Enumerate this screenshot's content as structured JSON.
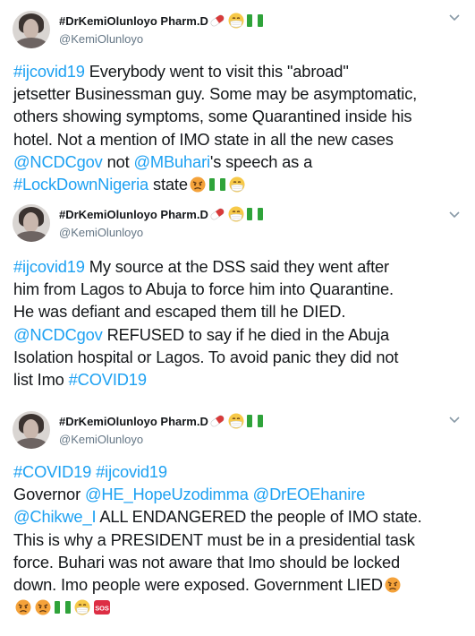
{
  "tweets": [
    {
      "display_name": "#DrKemiOlunloyo Pharm.D",
      "handle": "@KemiOlunloyo",
      "lines": [
        [
          {
            "t": "tag",
            "v": "#ijcovid19"
          },
          {
            "t": "text",
            "v": " Everybody went to visit this \"abroad\""
          }
        ],
        [
          {
            "t": "text",
            "v": "jetsetter Businessman guy. Some may be asymptomatic,"
          }
        ],
        [
          {
            "t": "text",
            "v": "others showing symptoms, some Quarantined inside his"
          }
        ],
        [
          {
            "t": "text",
            "v": "hotel. Not a mention of IMO state in all the new cases"
          }
        ],
        [
          {
            "t": "mention",
            "v": "@NCDCgov"
          },
          {
            "t": "text",
            "v": " not "
          },
          {
            "t": "mention",
            "v": "@MBuhari"
          },
          {
            "t": "text",
            "v": "'s speech as a"
          }
        ],
        [
          {
            "t": "tag",
            "v": "#LockDownNigeria"
          },
          {
            "t": "text",
            "v": " state"
          },
          {
            "t": "emoji",
            "v": "angry"
          },
          {
            "t": "emoji",
            "v": "flag-ng"
          },
          {
            "t": "emoji",
            "v": "mask"
          }
        ]
      ]
    },
    {
      "display_name": "#DrKemiOlunloyo Pharm.D",
      "handle": "@KemiOlunloyo",
      "lines": [
        [
          {
            "t": "tag",
            "v": "#ijcovid19"
          },
          {
            "t": "text",
            "v": " My source at the DSS said they went after"
          }
        ],
        [
          {
            "t": "text",
            "v": "him from Lagos to Abuja to force him into Quarantine."
          }
        ],
        [
          {
            "t": "text",
            "v": "He was defiant and escaped them till he DIED."
          }
        ],
        [
          {
            "t": "mention",
            "v": "@NCDCgov"
          },
          {
            "t": "text",
            "v": " REFUSED to say if he died in the Abuja"
          }
        ],
        [
          {
            "t": "text",
            "v": "Isolation hospital or Lagos. To avoid panic they did not"
          }
        ],
        [
          {
            "t": "text",
            "v": "list Imo "
          },
          {
            "t": "tag",
            "v": "#COVID19"
          }
        ]
      ]
    },
    {
      "display_name": "#DrKemiOlunloyo Pharm.D",
      "handle": "@KemiOlunloyo",
      "lines": [
        [
          {
            "t": "tag",
            "v": "#COVID19"
          },
          {
            "t": "text",
            "v": " "
          },
          {
            "t": "tag",
            "v": "#ijcovid19"
          }
        ],
        [
          {
            "t": "text",
            "v": "Governor "
          },
          {
            "t": "mention",
            "v": "@HE_HopeUzodimma"
          },
          {
            "t": "text",
            "v": " "
          },
          {
            "t": "mention",
            "v": "@DrEOEhanire"
          }
        ],
        [
          {
            "t": "mention",
            "v": "@Chikwe_I"
          },
          {
            "t": "text",
            "v": " ALL ENDANGERED the people of IMO state."
          }
        ],
        [
          {
            "t": "text",
            "v": "This is why a PRESIDENT must be in a presidential task"
          }
        ],
        [
          {
            "t": "text",
            "v": "force. Buhari was not aware that Imo should be locked"
          }
        ],
        [
          {
            "t": "text",
            "v": "down. Imo people were exposed. Government LIED"
          },
          {
            "t": "emoji",
            "v": "angry"
          }
        ],
        [
          {
            "t": "emoji",
            "v": "angry"
          },
          {
            "t": "emoji",
            "v": "angry"
          },
          {
            "t": "emoji",
            "v": "flag-ng"
          },
          {
            "t": "emoji",
            "v": "mask"
          },
          {
            "t": "emoji",
            "v": "sos"
          }
        ]
      ]
    }
  ],
  "name_emojis": [
    "pill",
    "mask",
    "flag-ng"
  ],
  "colors": {
    "link": "#1da1f2",
    "text": "#14171a",
    "muted": "#657786",
    "separator": "#e6ecf0"
  },
  "icons": {
    "menu": "chevron-down-icon",
    "avatar": "avatar"
  }
}
